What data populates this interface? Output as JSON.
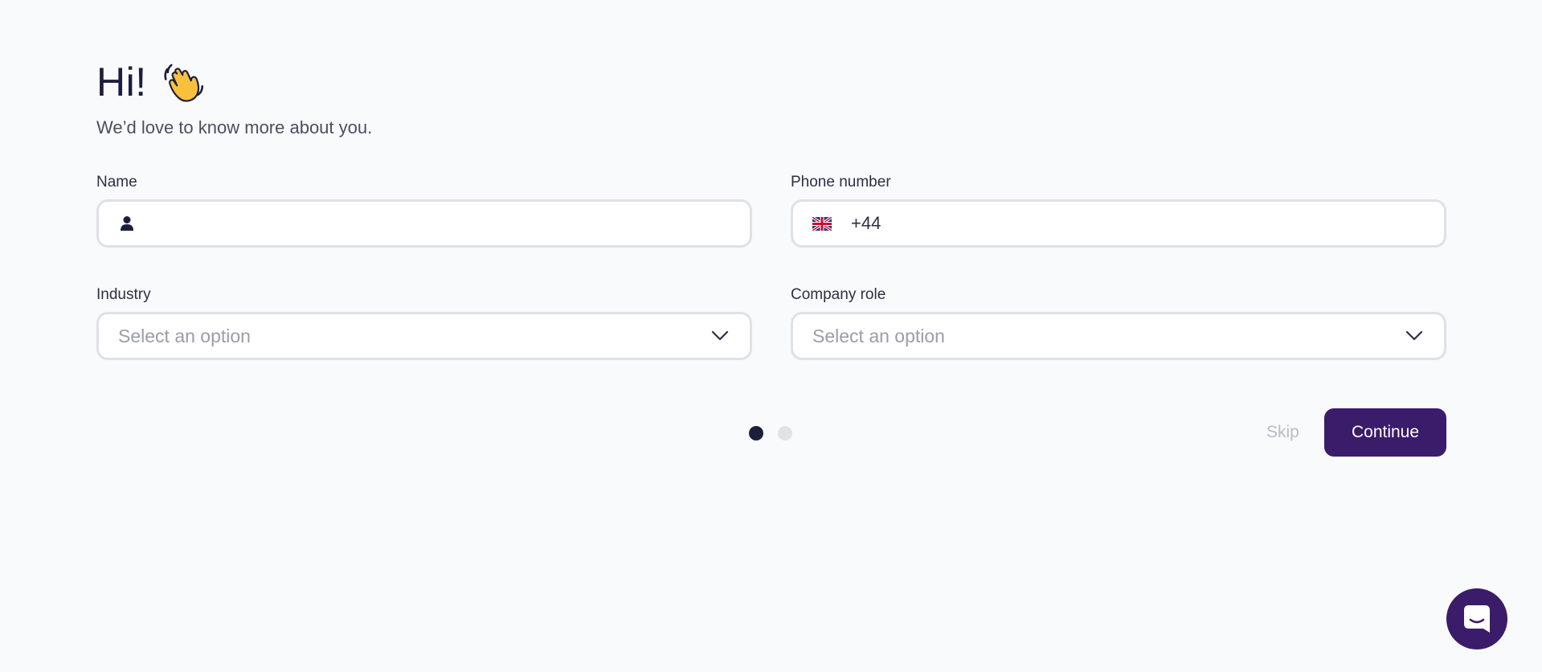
{
  "header": {
    "greeting": "Hi!",
    "subtitle": "We’d love to know more about you."
  },
  "form": {
    "name": {
      "label": "Name",
      "value": "",
      "icon": "person-icon"
    },
    "phone": {
      "label": "Phone number",
      "value": "+44",
      "icon": "uk-flag-icon"
    },
    "industry": {
      "label": "Industry",
      "placeholder": "Select an option"
    },
    "company_role": {
      "label": "Company role",
      "placeholder": "Select an option"
    }
  },
  "pagination": {
    "current_step": 1,
    "total_steps": 2
  },
  "actions": {
    "skip_label": "Skip",
    "continue_label": "Continue"
  },
  "colors": {
    "background": "#f9fafc",
    "primary": "#3a1c6b",
    "text": "#1c1f3b",
    "border": "#dfe1e6",
    "placeholder": "#9a9da8"
  },
  "chat": {
    "icon": "chat-icon"
  }
}
